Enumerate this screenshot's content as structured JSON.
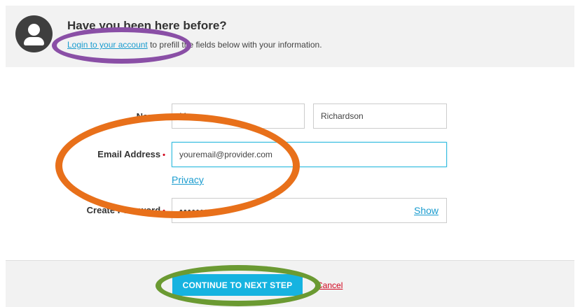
{
  "banner": {
    "title": "Have you been here before?",
    "login_link": "Login to your account",
    "subtitle_rest": " to prefill the fields below with your information.",
    "avatar_icon": "user-icon"
  },
  "form": {
    "name": {
      "label": "Name",
      "first_value": "Mae",
      "last_value": "Richardson"
    },
    "email": {
      "label": "Email Address",
      "required_mark": "•",
      "value": "youremail@provider.com",
      "privacy_link": "Privacy"
    },
    "password": {
      "label": "Create Password",
      "required_mark": "•",
      "value": "•••••••••••••",
      "show_link": "Show"
    }
  },
  "footer": {
    "continue_label": "CONTINUE TO NEXT STEP",
    "cancel_label": "Cancel"
  },
  "colors": {
    "accent": "#16b3e0",
    "link": "#1a9ccf",
    "required": "#d0021b",
    "annotation_purple": "#8a4fa6",
    "annotation_orange": "#e8701a",
    "annotation_green": "#6b9a32"
  }
}
